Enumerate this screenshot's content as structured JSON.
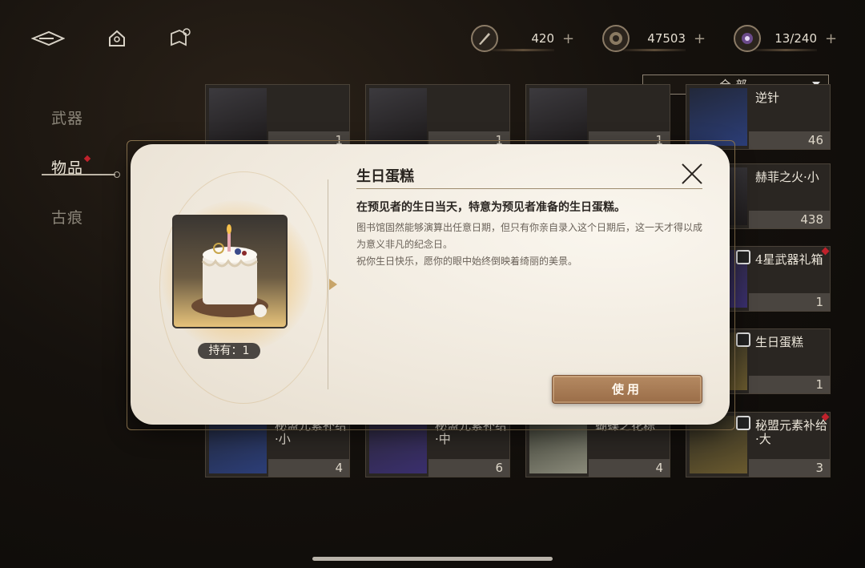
{
  "header": {
    "back_icon": "back-arrow-icon",
    "home_icon": "home-icon",
    "map_icon": "compass-map-icon",
    "resources": [
      {
        "name": "quill-icon",
        "value": "420",
        "plus": "+"
      },
      {
        "name": "coin-icon",
        "value": "47503",
        "plus": "+"
      },
      {
        "name": "crystal-icon",
        "value": "13/240",
        "plus": "+"
      }
    ]
  },
  "filter": {
    "label": "全部"
  },
  "sidebar": {
    "items": [
      {
        "label": "武器"
      },
      {
        "label": "物品"
      },
      {
        "label": "古痕"
      }
    ]
  },
  "grid": {
    "items": [
      {
        "name": "",
        "count": "1"
      },
      {
        "name": "",
        "count": "1"
      },
      {
        "name": "",
        "count": "1"
      },
      {
        "name": "逆针",
        "count": "46"
      },
      {
        "name": "赫菲之火·小",
        "count": "438"
      },
      {
        "name": "4星武器礼箱",
        "count": "1"
      },
      {
        "name": "生日蛋糕",
        "count": "1"
      },
      {
        "name": "秘盟元素补给·小",
        "count": "4"
      },
      {
        "name": "秘盟元素补给·中",
        "count": "6"
      },
      {
        "name": "蝴蝶之花粽",
        "count": "4"
      },
      {
        "name": "秘盟元素补给·大",
        "count": "3"
      }
    ]
  },
  "dialog": {
    "title": "生日蛋糕",
    "hold_label": "持有：1",
    "lead": "在预见者的生日当天，特意为预见者准备的生日蛋糕。",
    "body_1": "图书馆固然能够演算出任意日期，但只有你亲自录入这个日期后，这一天才得以成为意义非凡的纪念日。",
    "body_2": "祝你生日快乐，愿你的眼中始终倒映着绮丽的美景。",
    "use_label": "使用"
  },
  "colors": {
    "accent_red": "#c0222c",
    "dialog_bg": "#efe8dc",
    "button_brown": "#a67850"
  }
}
